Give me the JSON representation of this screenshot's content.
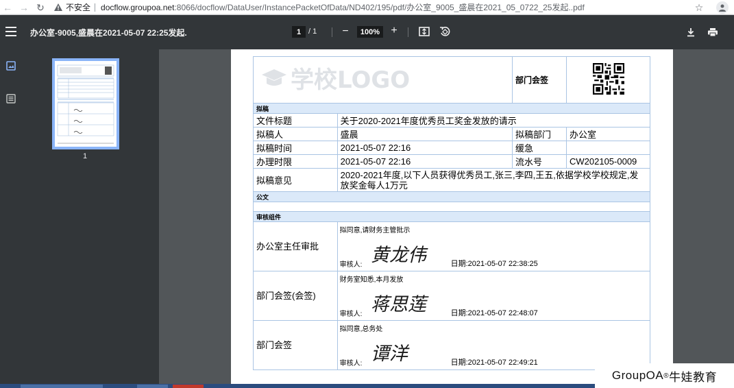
{
  "browser": {
    "insecure_label": "不安全",
    "url_host": "docflow.groupoa.net",
    "url_path": ":8066/docflow/DataUser/InstancePacketOfData/ND402/195/pdf/办公室_9005_盛晨在2021_05_0722_25发起..pdf"
  },
  "toolbar": {
    "title": "办公室-9005,盛晨在2021-05-07 22:25发起.",
    "current_page": "1",
    "total_pages": "/ 1",
    "zoom": "100%",
    "zoom_minus": "−",
    "zoom_plus": "+"
  },
  "sidebar": {
    "thumbnail_page_number": "1"
  },
  "form": {
    "logo_text": "学校LOGO",
    "dept_sign_label": "部门会签",
    "section_draft": "拟稿",
    "section_doc": "公文",
    "section_review": "审核组件",
    "rows": {
      "title_label": "文件标题",
      "title_value": "关于2020-2021年度优秀员工奖金发放的请示",
      "drafter_label": "拟稿人",
      "drafter_value": "盛晨",
      "dept_label": "拟稿部门",
      "dept_value": "办公室",
      "draft_time_label": "拟稿时间",
      "draft_time_value": "2021-05-07 22:16",
      "urgency_label": "缓急",
      "urgency_value": "",
      "deadline_label": "办理时限",
      "deadline_value": "2021-05-07 22:16",
      "serial_label": "流水号",
      "serial_value": "CW202105-0009",
      "opinion_label": "拟稿意见",
      "opinion_value": "2020-2021年度,以下人员获得优秀员工,张三,李四,王五,依据学校学校规定,发放奖金每人1万元"
    },
    "reviews": [
      {
        "label": "办公室主任审批",
        "note": "拟同意,请财务主管批示",
        "reviewer_label": "审核人:",
        "date": "日期:2021-05-07 22:38:25",
        "signature": "黄龙伟"
      },
      {
        "label": "部门会签(会签)",
        "note": "财务室知悉,本月发放",
        "reviewer_label": "审核人:",
        "date": "日期:2021-05-07 22:48:07",
        "signature": "蒋思莲"
      },
      {
        "label": "部门会签",
        "note": "拟同意,总务处",
        "reviewer_label": "审核人:",
        "date": "日期:2021-05-07 22:49:21",
        "signature": "谭洋"
      }
    ]
  },
  "watermark": {
    "brand": "GroupOA",
    "reg": "®",
    "suffix": "牛娃教育"
  }
}
